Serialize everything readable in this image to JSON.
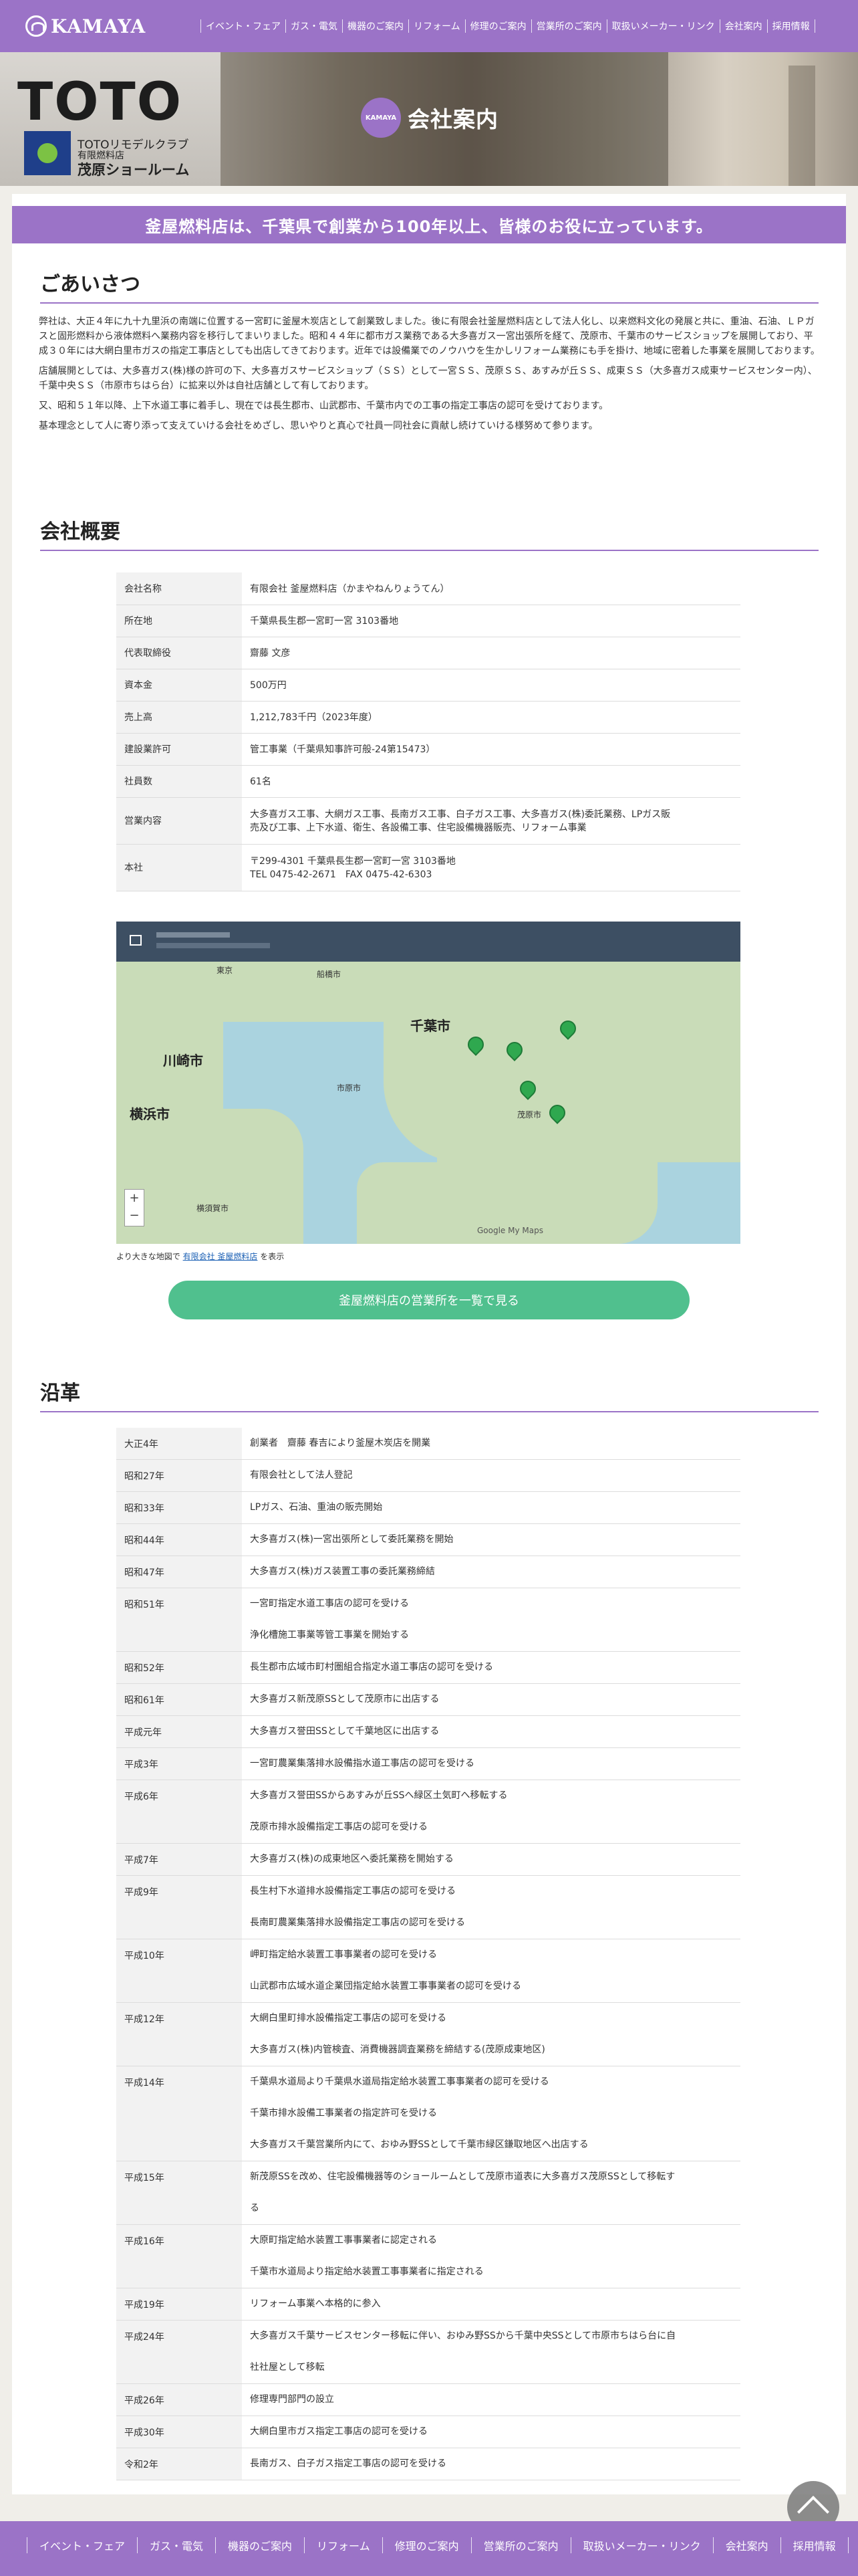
{
  "header": {
    "logo": "KAMAYA",
    "nav": [
      "イベント・フェア",
      "ガス・電気",
      "機器のご案内",
      "リフォーム",
      "修理のご案内",
      "営業所のご案内",
      "取扱いメーカー・リンク",
      "会社案内",
      "採用情報"
    ]
  },
  "hero": {
    "brand": "TOTO",
    "sub_small": "TOTOリモデルクラブ",
    "sub1": "TOTOリモデルクラブ",
    "sub2": "有限燃料店",
    "sub3": "茂原ショールーム",
    "badge_text": "KAMAYA",
    "title": "会社案内"
  },
  "banner": "釜屋燃料店は、千葉県で創業から100年以上、皆様のお役に立っています。",
  "greeting": {
    "title": "ごあいさつ",
    "paragraphs": [
      "弊社は、大正４年に九十九里浜の南端に位置する一宮町に釜屋木炭店として創業致しました。後に有限会社釜屋燃料店として法人化し、以来燃料文化の発展と共に、重油、石油、ＬＰガスと固形燃料から液体燃料へ業務内容を移行してまいりました。昭和４４年に都市ガス業務である大多喜ガス一宮出張所を経て、茂原市、千葉市のサービスショップを展開しており、平成３０年には大網白里市ガスの指定工事店としても出店してきております。近年では設備業でのノウハウを生かしリフォーム業務にも手を掛け、地域に密着した事業を展開しております。",
      "店舗展開としては、大多喜ガス(株)様の許可の下、大多喜ガスサービスショップ（ＳＳ）として一宮ＳＳ、茂原ＳＳ、あすみが丘ＳＳ、成東ＳＳ（大多喜ガス成東サービスセンター内）、千葉中央ＳＳ（市原市ちはら台）に拡来以外は自社店舗として有しております。",
      "又、昭和５１年以降、上下水道工事に着手し、現在では長生郡市、山武郡市、千葉市内での工事の指定工事店の認可を受けております。",
      "基本理念として人に寄り添って支えていける会社をめざし、思いやりと真心で社員一同社会に貢献し続けていける様努めて参ります。"
    ]
  },
  "company": {
    "title": "会社概要",
    "rows": [
      {
        "k": "会社名称",
        "v": [
          "有限会社 釜屋燃料店（かまやねんりょうてん）"
        ]
      },
      {
        "k": "所在地",
        "v": [
          "千葉県長生郡一宮町一宮 3103番地"
        ]
      },
      {
        "k": "代表取締役",
        "v": [
          "齋藤 文彦"
        ]
      },
      {
        "k": "資本金",
        "v": [
          "500万円"
        ]
      },
      {
        "k": "売上高",
        "v": [
          "1,212,783千円（2023年度）"
        ]
      },
      {
        "k": "建設業許可",
        "v": [
          "管工事業（千葉県知事許可般-24第15473）"
        ]
      },
      {
        "k": "社員数",
        "v": [
          "61名"
        ]
      },
      {
        "k": "営業内容",
        "v": [
          "大多喜ガス工事、大網ガス工事、長南ガス工事、白子ガス工事、大多喜ガス(株)委託業務、LPガス販",
          "売及び工事、上下水道、衛生、各設備工事、住宅設備機器販売、リフォーム事業"
        ]
      },
      {
        "k": "本社",
        "v": [
          "〒299-4301 千葉県長生郡一宮町一宮 3103番地",
          "TEL 0475-42-2671　FAX 0475-42-6303"
        ]
      }
    ]
  },
  "map": {
    "labels": {
      "tokyo": "東京",
      "chiba": "千葉市",
      "kawasaki": "川崎市",
      "yokohama": "横浜市",
      "funabashi": "船橋市",
      "yokosuka": "横須賀市",
      "ichihara": "市原市",
      "mobara": "茂原市"
    },
    "caption_prefix": "より大きな地図で",
    "caption_link": "有限会社 釜屋燃料店",
    "caption_suffix": "を表示",
    "google": "Google My Maps"
  },
  "cta_button": "釜屋燃料店の営業所を一覧で見る",
  "history": {
    "title": "沿革",
    "rows": [
      {
        "k": "大正4年",
        "v": [
          "創業者　齋藤 春吉により釜屋木炭店を開業"
        ]
      },
      {
        "k": "昭和27年",
        "v": [
          "有限会社として法人登記"
        ]
      },
      {
        "k": "昭和33年",
        "v": [
          "LPガス、石油、重油の販売開始"
        ]
      },
      {
        "k": "昭和44年",
        "v": [
          "大多喜ガス(株)一宮出張所として委託業務を開始"
        ]
      },
      {
        "k": "昭和47年",
        "v": [
          "大多喜ガス(株)ガス装置工事の委託業務締結"
        ]
      },
      {
        "k": "昭和51年",
        "v": [
          "一宮町指定水道工事店の認可を受ける",
          "浄化槽施工事業等管工事業を開始する"
        ]
      },
      {
        "k": "昭和52年",
        "v": [
          "長生郡市広域市町村圏組合指定水道工事店の認可を受ける"
        ]
      },
      {
        "k": "昭和61年",
        "v": [
          "大多喜ガス新茂原SSとして茂原市に出店する"
        ]
      },
      {
        "k": "平成元年",
        "v": [
          "大多喜ガス誉田SSとして千葉地区に出店する"
        ]
      },
      {
        "k": "平成3年",
        "v": [
          "一宮町農業集落排水設備指水道工事店の認可を受ける"
        ]
      },
      {
        "k": "平成6年",
        "v": [
          "大多喜ガス誉田SSからあすみが丘SSへ緑区土気町へ移転する",
          "茂原市排水設備指定工事店の認可を受ける"
        ]
      },
      {
        "k": "平成7年",
        "v": [
          "大多喜ガス(株)の成東地区へ委託業務を開始する"
        ]
      },
      {
        "k": "平成9年",
        "v": [
          "長生村下水道排水設備指定工事店の認可を受ける",
          "長南町農業集落排水設備指定工事店の認可を受ける"
        ]
      },
      {
        "k": "平成10年",
        "v": [
          "岬町指定給水装置工事事業者の認可を受ける",
          "山武郡市広域水道企業団指定給水装置工事事業者の認可を受ける"
        ]
      },
      {
        "k": "平成12年",
        "v": [
          "大網白里町排水設備指定工事店の認可を受ける",
          "大多喜ガス(株)内管検査、消費機器調査業務を締結する(茂原成東地区)"
        ]
      },
      {
        "k": "平成14年",
        "v": [
          "千葉県水道局より千葉県水道局指定給水装置工事事業者の認可を受ける",
          "千葉市排水設備工事業者の指定許可を受ける",
          "大多喜ガス千葉営業所内にて、おゆみ野SSとして千葉市緑区鎌取地区へ出店する"
        ]
      },
      {
        "k": "平成15年",
        "v": [
          "新茂原SSを改め、住宅設備機器等のショールームとして茂原市道表に大多喜ガス茂原SSとして移転す",
          "る"
        ]
      },
      {
        "k": "平成16年",
        "v": [
          "大原町指定給水装置工事事業者に認定される",
          "千葉市水道局より指定給水装置工事事業者に指定される"
        ]
      },
      {
        "k": "平成19年",
        "v": [
          "リフォーム事業へ本格的に参入"
        ]
      },
      {
        "k": "平成24年",
        "v": [
          "大多喜ガス千葉サービスセンター移転に伴い、おゆみ野SSから千葉中央SSとして市原市ちはら台に自",
          "社社屋として移転"
        ]
      },
      {
        "k": "平成26年",
        "v": [
          "修理専門部門の設立"
        ]
      },
      {
        "k": "平成30年",
        "v": [
          "大網白里市ガス指定工事店の認可を受ける"
        ]
      },
      {
        "k": "令和2年",
        "v": [
          "長南ガス、白子ガス指定工事店の認可を受ける"
        ]
      }
    ]
  },
  "footer": {
    "nav": [
      "イベント・フェア",
      "ガス・電気",
      "機器のご案内",
      "リフォーム",
      "修理のご案内",
      "営業所のご案内",
      "取扱いメーカー・リンク",
      "会社案内",
      "採用情報"
    ]
  },
  "colors": {
    "accent": "#9b73c7",
    "cta": "#50c08e"
  }
}
